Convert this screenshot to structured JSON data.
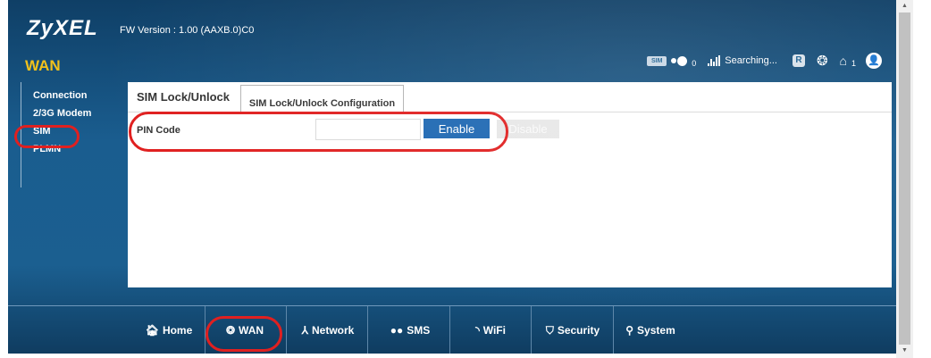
{
  "header": {
    "logo": "ZyXEL",
    "fw_version": "FW Version : 1.00 (AAXB.0)C0",
    "section_title": "WAN"
  },
  "status": {
    "sim_label": "SIM",
    "message_count": "0",
    "signal_text": "Searching...",
    "roaming_label": "R",
    "client_count": "1"
  },
  "sidebar": {
    "items": [
      {
        "label": "Connection"
      },
      {
        "label": "2/3G Modem"
      },
      {
        "label": "SIM"
      },
      {
        "label": "PLMN"
      }
    ]
  },
  "tabs": {
    "active": "SIM Lock/Unlock",
    "secondary": "SIM Lock/Unlock Configuration"
  },
  "form": {
    "pin_label": "PIN Code",
    "pin_value": "",
    "enable_label": "Enable",
    "disable_label": "Disable"
  },
  "nav": {
    "items": [
      {
        "label": "Home",
        "icon": "home-icon"
      },
      {
        "label": "WAN",
        "icon": "globe-icon"
      },
      {
        "label": "Network",
        "icon": "network-icon"
      },
      {
        "label": "SMS",
        "icon": "sms-icon"
      },
      {
        "label": "WiFi",
        "icon": "wifi-icon"
      },
      {
        "label": "Security",
        "icon": "shield-icon"
      },
      {
        "label": "System",
        "icon": "system-icon"
      }
    ]
  },
  "colors": {
    "accent_yellow": "#f2c11b",
    "enable_button": "#1d67b2",
    "annotation_red": "#e02020"
  }
}
